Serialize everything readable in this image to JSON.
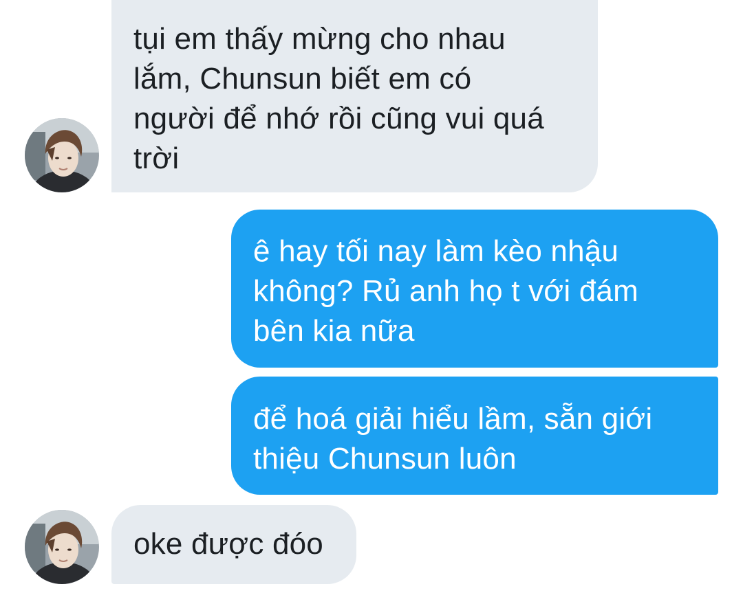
{
  "conversation": {
    "messages": [
      {
        "direction": "incoming",
        "text": "tụi em thấy mừng cho nhau\nlắm, Chunsun biết em có\nngười để nhớ rồi cũng vui quá\ntrời"
      },
      {
        "direction": "outgoing",
        "text": "ê hay tối nay làm kèo nhậu\nkhông? Rủ anh họ t với đám\nbên kia nữa"
      },
      {
        "direction": "outgoing",
        "text": "để hoá giải hiểu lầm, sẵn giới\nthiệu Chunsun luôn"
      },
      {
        "direction": "incoming",
        "text": "oke được đóo"
      }
    ]
  },
  "colors": {
    "incoming_bubble": "#e6ebf0",
    "outgoing_bubble": "#1da1f2",
    "incoming_text": "#1b1f23",
    "outgoing_text": "#ffffff"
  },
  "icons": {
    "avatar": "contact-avatar-photo"
  }
}
